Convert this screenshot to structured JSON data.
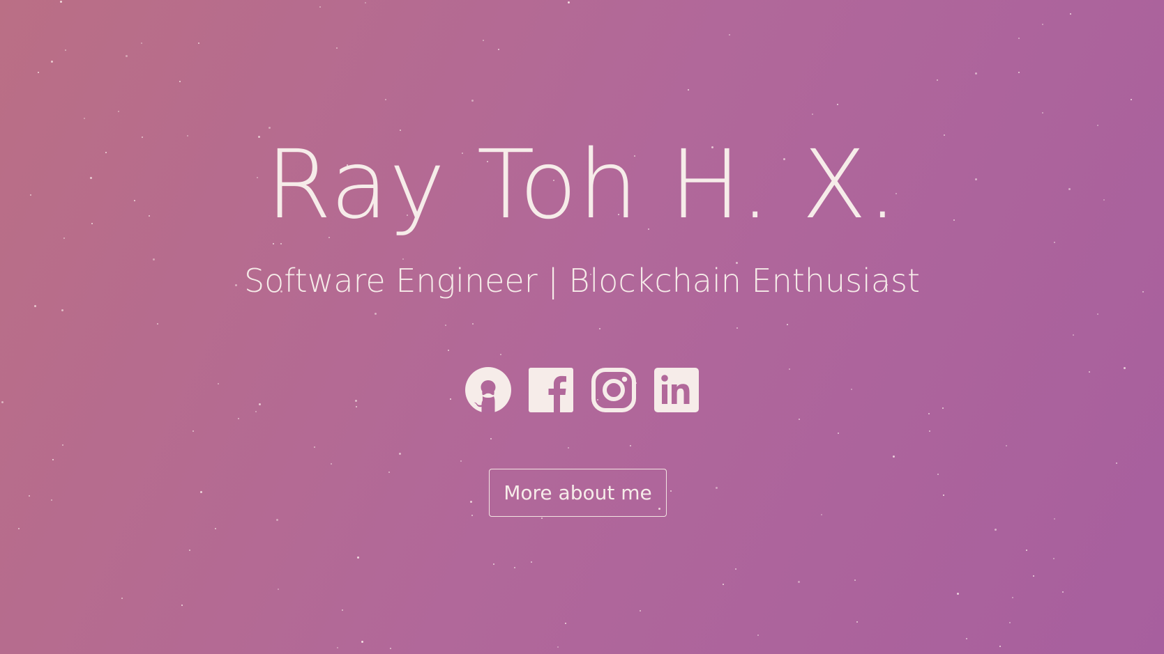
{
  "hero": {
    "name": "Ray Toh H. X.",
    "tagline": "Software Engineer | Blockchain Enthusiast"
  },
  "social_links": [
    {
      "icon": "github-icon"
    },
    {
      "icon": "facebook-icon"
    },
    {
      "icon": "instagram-icon"
    },
    {
      "icon": "linkedin-icon"
    }
  ],
  "cta": {
    "label": "More about me"
  },
  "colors": {
    "background_start": "#ba6f85",
    "background_end": "#a75f9e",
    "foreground": "#f6ece9"
  }
}
